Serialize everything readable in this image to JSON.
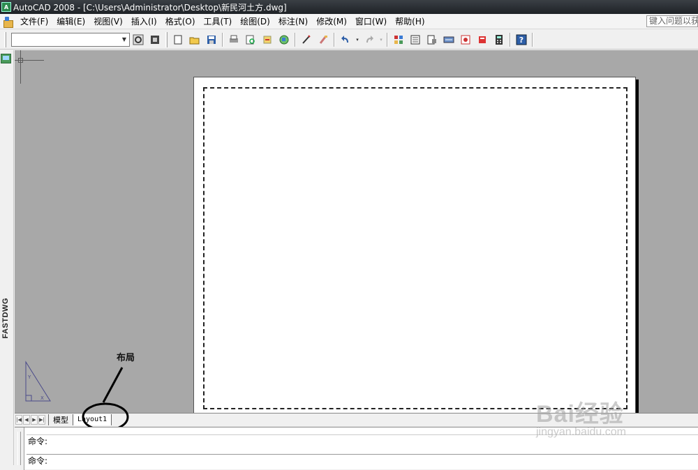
{
  "window": {
    "title": "AutoCAD 2008 - [C:\\Users\\Administrator\\Desktop\\新民河土方.dwg]",
    "app_icon": "autocad-app-icon"
  },
  "menubar": {
    "items": [
      "文件(F)",
      "编辑(E)",
      "视图(V)",
      "插入(I)",
      "格式(O)",
      "工具(T)",
      "绘图(D)",
      "标注(N)",
      "修改(M)",
      "窗口(W)",
      "帮助(H)"
    ],
    "help_search": "键入问题以获"
  },
  "toolbar": {
    "workspace_value": "",
    "icons": [
      "workspace-settings-icon",
      "workspace-lock-icon",
      "new-file-icon",
      "open-file-icon",
      "save-icon",
      "print-icon",
      "print-preview-icon",
      "publish-icon",
      "3d-dwf-icon",
      "cut-icon",
      "match-properties-icon",
      "undo-icon",
      "redo-icon",
      "pan-icon",
      "properties-icon",
      "design-center-icon",
      "tool-palettes-icon",
      "sheet-set-icon",
      "markup-icon",
      "calculator-icon",
      "help-icon"
    ]
  },
  "left_panel": {
    "label": "FASTDWG"
  },
  "drawing": {
    "background": "#a8a8a8",
    "paper": "#ffffff"
  },
  "annotation": {
    "label": "布局"
  },
  "tabs": {
    "model": "模型",
    "layout": "Layout1"
  },
  "command": {
    "line1": "命令:",
    "line2": "命令:"
  },
  "watermark": {
    "brand": "Bai经验",
    "url": "jingyan.baidu.com"
  }
}
